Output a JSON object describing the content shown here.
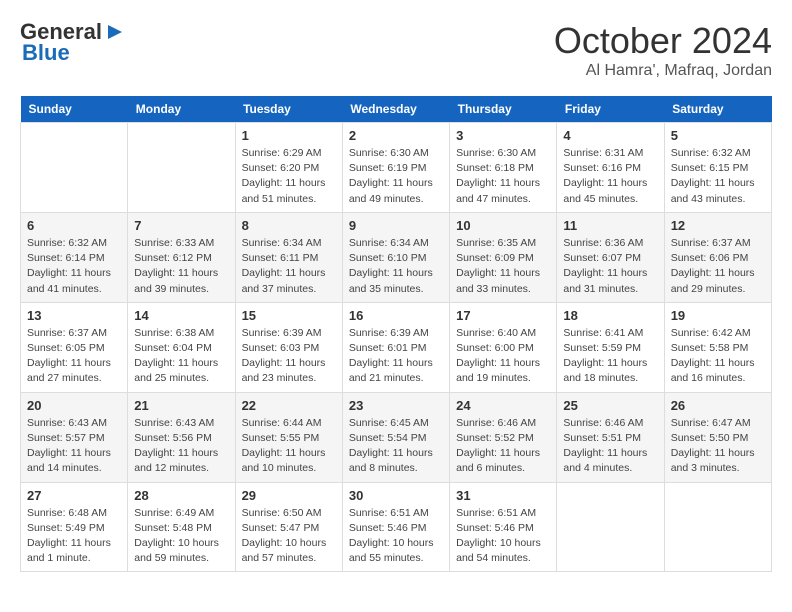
{
  "logo": {
    "line1": "General",
    "line2": "Blue"
  },
  "title": "October 2024",
  "subtitle": "Al Hamra', Mafraq, Jordan",
  "weekdays": [
    "Sunday",
    "Monday",
    "Tuesday",
    "Wednesday",
    "Thursday",
    "Friday",
    "Saturday"
  ],
  "weeks": [
    [
      {
        "day": "",
        "sunrise": "",
        "sunset": "",
        "daylight": ""
      },
      {
        "day": "",
        "sunrise": "",
        "sunset": "",
        "daylight": ""
      },
      {
        "day": "1",
        "sunrise": "Sunrise: 6:29 AM",
        "sunset": "Sunset: 6:20 PM",
        "daylight": "Daylight: 11 hours and 51 minutes."
      },
      {
        "day": "2",
        "sunrise": "Sunrise: 6:30 AM",
        "sunset": "Sunset: 6:19 PM",
        "daylight": "Daylight: 11 hours and 49 minutes."
      },
      {
        "day": "3",
        "sunrise": "Sunrise: 6:30 AM",
        "sunset": "Sunset: 6:18 PM",
        "daylight": "Daylight: 11 hours and 47 minutes."
      },
      {
        "day": "4",
        "sunrise": "Sunrise: 6:31 AM",
        "sunset": "Sunset: 6:16 PM",
        "daylight": "Daylight: 11 hours and 45 minutes."
      },
      {
        "day": "5",
        "sunrise": "Sunrise: 6:32 AM",
        "sunset": "Sunset: 6:15 PM",
        "daylight": "Daylight: 11 hours and 43 minutes."
      }
    ],
    [
      {
        "day": "6",
        "sunrise": "Sunrise: 6:32 AM",
        "sunset": "Sunset: 6:14 PM",
        "daylight": "Daylight: 11 hours and 41 minutes."
      },
      {
        "day": "7",
        "sunrise": "Sunrise: 6:33 AM",
        "sunset": "Sunset: 6:12 PM",
        "daylight": "Daylight: 11 hours and 39 minutes."
      },
      {
        "day": "8",
        "sunrise": "Sunrise: 6:34 AM",
        "sunset": "Sunset: 6:11 PM",
        "daylight": "Daylight: 11 hours and 37 minutes."
      },
      {
        "day": "9",
        "sunrise": "Sunrise: 6:34 AM",
        "sunset": "Sunset: 6:10 PM",
        "daylight": "Daylight: 11 hours and 35 minutes."
      },
      {
        "day": "10",
        "sunrise": "Sunrise: 6:35 AM",
        "sunset": "Sunset: 6:09 PM",
        "daylight": "Daylight: 11 hours and 33 minutes."
      },
      {
        "day": "11",
        "sunrise": "Sunrise: 6:36 AM",
        "sunset": "Sunset: 6:07 PM",
        "daylight": "Daylight: 11 hours and 31 minutes."
      },
      {
        "day": "12",
        "sunrise": "Sunrise: 6:37 AM",
        "sunset": "Sunset: 6:06 PM",
        "daylight": "Daylight: 11 hours and 29 minutes."
      }
    ],
    [
      {
        "day": "13",
        "sunrise": "Sunrise: 6:37 AM",
        "sunset": "Sunset: 6:05 PM",
        "daylight": "Daylight: 11 hours and 27 minutes."
      },
      {
        "day": "14",
        "sunrise": "Sunrise: 6:38 AM",
        "sunset": "Sunset: 6:04 PM",
        "daylight": "Daylight: 11 hours and 25 minutes."
      },
      {
        "day": "15",
        "sunrise": "Sunrise: 6:39 AM",
        "sunset": "Sunset: 6:03 PM",
        "daylight": "Daylight: 11 hours and 23 minutes."
      },
      {
        "day": "16",
        "sunrise": "Sunrise: 6:39 AM",
        "sunset": "Sunset: 6:01 PM",
        "daylight": "Daylight: 11 hours and 21 minutes."
      },
      {
        "day": "17",
        "sunrise": "Sunrise: 6:40 AM",
        "sunset": "Sunset: 6:00 PM",
        "daylight": "Daylight: 11 hours and 19 minutes."
      },
      {
        "day": "18",
        "sunrise": "Sunrise: 6:41 AM",
        "sunset": "Sunset: 5:59 PM",
        "daylight": "Daylight: 11 hours and 18 minutes."
      },
      {
        "day": "19",
        "sunrise": "Sunrise: 6:42 AM",
        "sunset": "Sunset: 5:58 PM",
        "daylight": "Daylight: 11 hours and 16 minutes."
      }
    ],
    [
      {
        "day": "20",
        "sunrise": "Sunrise: 6:43 AM",
        "sunset": "Sunset: 5:57 PM",
        "daylight": "Daylight: 11 hours and 14 minutes."
      },
      {
        "day": "21",
        "sunrise": "Sunrise: 6:43 AM",
        "sunset": "Sunset: 5:56 PM",
        "daylight": "Daylight: 11 hours and 12 minutes."
      },
      {
        "day": "22",
        "sunrise": "Sunrise: 6:44 AM",
        "sunset": "Sunset: 5:55 PM",
        "daylight": "Daylight: 11 hours and 10 minutes."
      },
      {
        "day": "23",
        "sunrise": "Sunrise: 6:45 AM",
        "sunset": "Sunset: 5:54 PM",
        "daylight": "Daylight: 11 hours and 8 minutes."
      },
      {
        "day": "24",
        "sunrise": "Sunrise: 6:46 AM",
        "sunset": "Sunset: 5:52 PM",
        "daylight": "Daylight: 11 hours and 6 minutes."
      },
      {
        "day": "25",
        "sunrise": "Sunrise: 6:46 AM",
        "sunset": "Sunset: 5:51 PM",
        "daylight": "Daylight: 11 hours and 4 minutes."
      },
      {
        "day": "26",
        "sunrise": "Sunrise: 6:47 AM",
        "sunset": "Sunset: 5:50 PM",
        "daylight": "Daylight: 11 hours and 3 minutes."
      }
    ],
    [
      {
        "day": "27",
        "sunrise": "Sunrise: 6:48 AM",
        "sunset": "Sunset: 5:49 PM",
        "daylight": "Daylight: 11 hours and 1 minute."
      },
      {
        "day": "28",
        "sunrise": "Sunrise: 6:49 AM",
        "sunset": "Sunset: 5:48 PM",
        "daylight": "Daylight: 10 hours and 59 minutes."
      },
      {
        "day": "29",
        "sunrise": "Sunrise: 6:50 AM",
        "sunset": "Sunset: 5:47 PM",
        "daylight": "Daylight: 10 hours and 57 minutes."
      },
      {
        "day": "30",
        "sunrise": "Sunrise: 6:51 AM",
        "sunset": "Sunset: 5:46 PM",
        "daylight": "Daylight: 10 hours and 55 minutes."
      },
      {
        "day": "31",
        "sunrise": "Sunrise: 6:51 AM",
        "sunset": "Sunset: 5:46 PM",
        "daylight": "Daylight: 10 hours and 54 minutes."
      },
      {
        "day": "",
        "sunrise": "",
        "sunset": "",
        "daylight": ""
      },
      {
        "day": "",
        "sunrise": "",
        "sunset": "",
        "daylight": ""
      }
    ]
  ]
}
